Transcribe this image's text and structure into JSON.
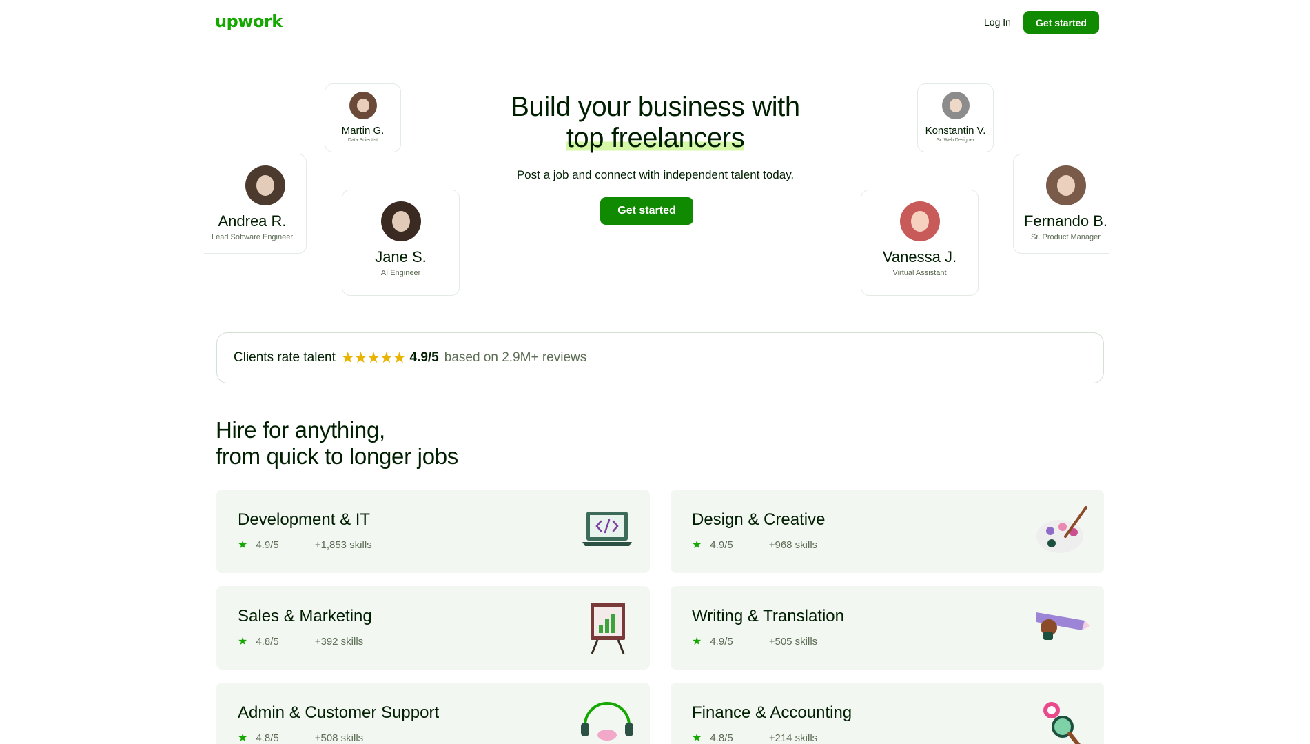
{
  "header": {
    "logo": "upwork",
    "login": "Log In",
    "cta": "Get started"
  },
  "hero": {
    "title_line1": "Build your business with",
    "title_line2": "top freelancers",
    "subtitle": "Post a job and connect with independent talent today.",
    "cta": "Get started"
  },
  "freelancers": [
    {
      "name": "Martin G.",
      "role": "Data Scientist",
      "color": "#6b4a3a"
    },
    {
      "name": "Andrea R.",
      "role": "Lead Software Engineer",
      "color": "#4d3a2e"
    },
    {
      "name": "Jane S.",
      "role": "AI Engineer",
      "color": "#3a2a22"
    },
    {
      "name": "Konstantin V.",
      "role": "Sr. Web Designer",
      "color": "#8c8c8c"
    },
    {
      "name": "Vanessa J.",
      "role": "Virtual Assistant",
      "color": "#c95a5a"
    },
    {
      "name": "Fernando B.",
      "role": "Sr. Product Manager",
      "color": "#7a5a48"
    }
  ],
  "rating": {
    "label": "Clients rate talent",
    "stars": "★★★★★",
    "score": "4.9/5",
    "based": "based on 2.9M+ reviews"
  },
  "section": {
    "title_line1": "Hire for anything,",
    "title_line2": "from quick to longer jobs"
  },
  "categories": [
    {
      "name": "Development & IT",
      "rating": "4.9/5",
      "skills": "+1,853 skills",
      "icon": "laptop-code-icon"
    },
    {
      "name": "Design & Creative",
      "rating": "4.9/5",
      "skills": "+968 skills",
      "icon": "palette-icon"
    },
    {
      "name": "Sales & Marketing",
      "rating": "4.8/5",
      "skills": "+392 skills",
      "icon": "chart-easel-icon"
    },
    {
      "name": "Writing & Translation",
      "rating": "4.9/5",
      "skills": "+505 skills",
      "icon": "pencil-hand-icon"
    },
    {
      "name": "Admin & Customer Support",
      "rating": "4.8/5",
      "skills": "+508 skills",
      "icon": "headset-icon"
    },
    {
      "name": "Finance & Accounting",
      "rating": "4.8/5",
      "skills": "+214 skills",
      "icon": "magnifier-icon"
    }
  ],
  "colors": {
    "brand_green": "#14a800",
    "button_green": "#108a00",
    "highlight": "#d7f7a8",
    "card_bg": "#f2f7f2",
    "star_gold": "#e8b400"
  }
}
